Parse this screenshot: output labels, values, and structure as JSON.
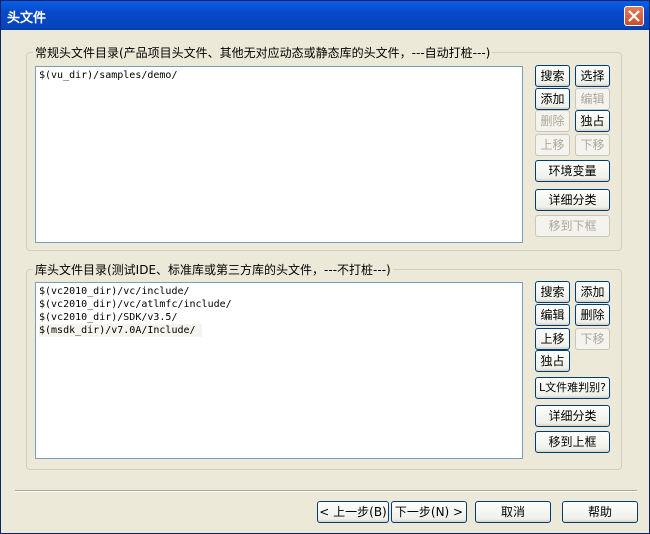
{
  "window": {
    "title": "头文件"
  },
  "group1": {
    "legend": "常规头文件目录(产品项目头文件、其他无对应动态或静态库的头文件，---自动打桩---)",
    "items": [
      "$(vu_dir)/samples/demo/"
    ],
    "buttons": {
      "search": "搜索",
      "select": "选择",
      "add": "添加",
      "edit": "编辑",
      "delete": "删除",
      "exclusive": "独占",
      "up": "上移",
      "down": "下移",
      "env": "环境变量",
      "detail": "详细分类",
      "move_down_frame": "移到下框"
    }
  },
  "group2": {
    "legend": "库头文件目录(测试IDE、标准库或第三方库的头文件，---不打桩---)",
    "items": [
      "$(vc2010_dir)/vc/include/",
      "$(vc2010_dir)/vc/atlmfc/include/",
      "$(vc2010_dir)/SDK/v3.5/",
      "$(msdk_dir)/v7.0A/Include/"
    ],
    "buttons": {
      "search": "搜索",
      "add": "添加",
      "edit": "编辑",
      "delete": "删除",
      "up": "上移",
      "down": "下移",
      "exclusive": "独占",
      "l_file_hard": "L文件难判别?",
      "detail": "详细分类",
      "move_up_frame": "移到上框"
    }
  },
  "footer": {
    "prev": "< 上一步(B)",
    "next": "下一步(N) >",
    "cancel": "取消",
    "help": "帮助"
  }
}
